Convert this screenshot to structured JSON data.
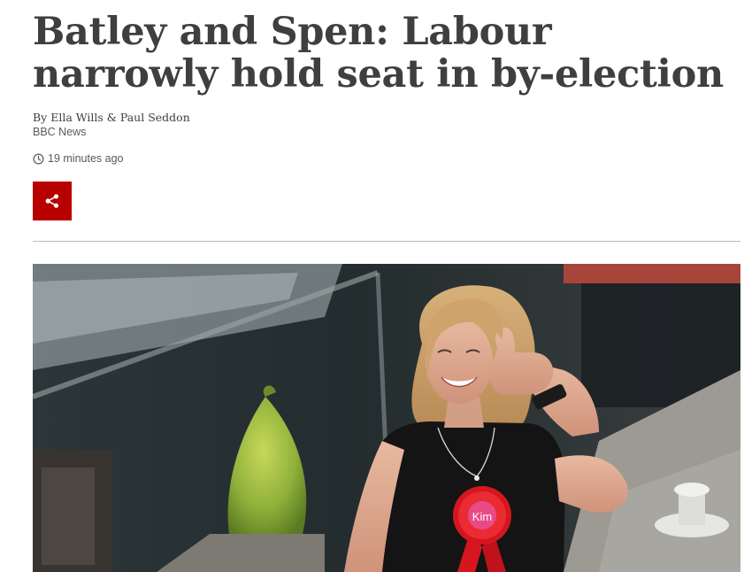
{
  "article": {
    "headline": "Batley and Spen: Labour narrowly hold seat in by-election",
    "byline": "By Ella Wills & Paul Seddon",
    "source": "BBC News",
    "timestamp": "19 minutes ago"
  },
  "share": {
    "icon": "share-icon",
    "accent": "#b80000"
  },
  "photo": {
    "rosette_text": "Kim",
    "rosette_color": "#d6161e"
  }
}
